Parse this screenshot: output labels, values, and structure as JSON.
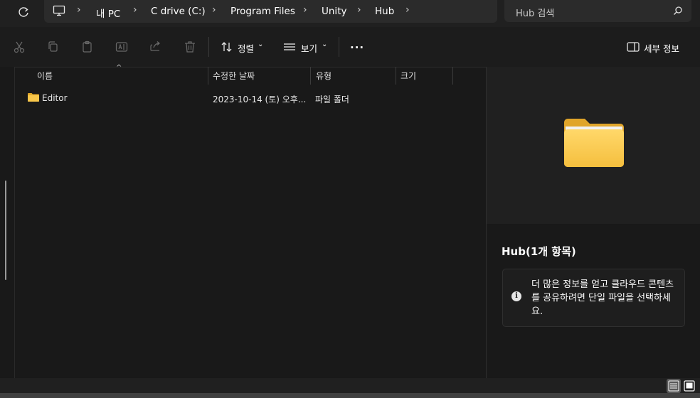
{
  "address_bar": {
    "crumbs": [
      "내 PC",
      "C drive (C:)",
      "Program Files",
      "Unity",
      "Hub"
    ]
  },
  "search": {
    "placeholder": "Hub 검색"
  },
  "toolbar": {
    "sort_label": "정렬",
    "view_label": "보기",
    "more_label": "...",
    "details_label": "세부 정보"
  },
  "columns": {
    "name": "이름",
    "modified": "수정한 날짜",
    "type": "유형",
    "size": "크기"
  },
  "files": [
    {
      "name": "Editor",
      "modified": "2023-10-14 (토) 오후...",
      "type": "파일 폴더",
      "size": ""
    }
  ],
  "details": {
    "title": "Hub(1개 항목)",
    "info": "더 많은 정보를 얻고 클라우드 콘텐츠를 공유하려면 단일 파일을 선택하세요."
  },
  "colors": {
    "folder_yellow": "#f8c64a",
    "background": "#191919",
    "pane": "#202020"
  }
}
